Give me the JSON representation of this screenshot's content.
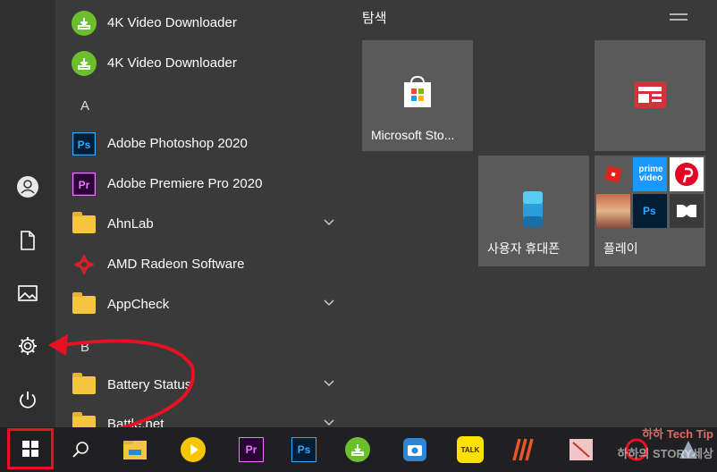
{
  "start_menu": {
    "apps": [
      {
        "label": "4K Video Downloader",
        "icon": "4k-video-downloader-icon",
        "expandable": false
      },
      {
        "label": "4K Video Downloader",
        "icon": "4k-video-downloader-icon",
        "expandable": false
      },
      {
        "label": "Adobe Photoshop 2020",
        "icon": "photoshop-icon",
        "expandable": false
      },
      {
        "label": "Adobe Premiere Pro 2020",
        "icon": "premiere-pro-icon",
        "expandable": false
      },
      {
        "label": "AhnLab",
        "icon": "folder-icon",
        "expandable": true
      },
      {
        "label": "AMD Radeon Software",
        "icon": "amd-radeon-icon",
        "expandable": false
      },
      {
        "label": "AppCheck",
        "icon": "folder-icon",
        "expandable": true
      },
      {
        "label": "Battery Status",
        "icon": "folder-icon",
        "expandable": true
      },
      {
        "label": "Battle.net",
        "icon": "folder-icon",
        "expandable": true
      }
    ],
    "letters": {
      "a": "A",
      "b": "B"
    },
    "rail": [
      "user-icon",
      "document-icon",
      "pictures-icon",
      "settings-icon",
      "power-icon"
    ]
  },
  "tiles": {
    "group_title": "탐색",
    "store_label": "Microsoft Sto...",
    "phone_label": "사용자 휴대폰",
    "play_label": "플레이",
    "prime_text": "prime video",
    "ps_text": "Ps"
  },
  "taskbar": {
    "icons": [
      "start-button",
      "search-icon",
      "file-explorer-icon",
      "media-player-icon",
      "premiere-pro-icon",
      "photoshop-icon",
      "4k-video-downloader-icon",
      "camera-icon",
      "kakaotalk-icon",
      "app-icon",
      "snipping-icon",
      "app-icon"
    ],
    "kakao_text": "TALK",
    "pr_text": "Pr",
    "ps_text": "Ps"
  },
  "watermark": {
    "line1": "하하 Tech Tip",
    "line2": "하하의 STORY세상"
  },
  "annotation": {
    "color": "#e81123"
  }
}
